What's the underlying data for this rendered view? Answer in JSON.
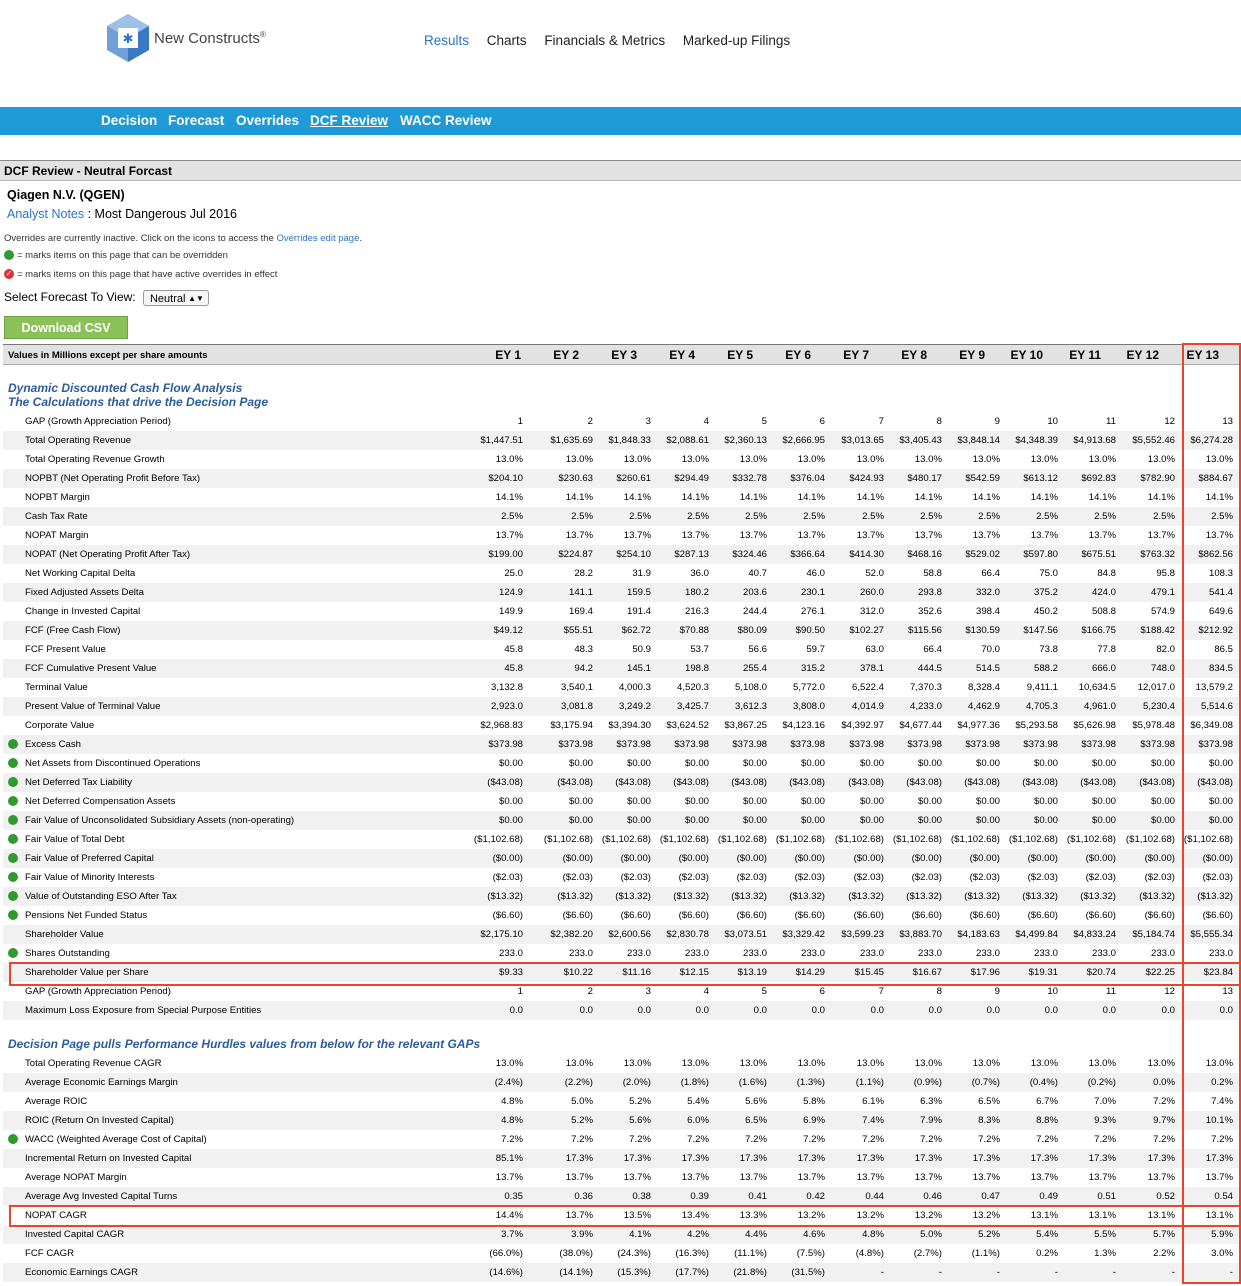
{
  "brand": {
    "name": "New Constructs",
    "mark": "®"
  },
  "topnav": [
    "Results",
    "Charts",
    "Financials & Metrics",
    "Marked-up Filings"
  ],
  "subnav": [
    "Decision",
    "Forecast",
    "Overrides",
    "DCF Review",
    "WACC Review"
  ],
  "section_title": "DCF Review - Neutral Forcast",
  "company": "Qiagen N.V. (QGEN)",
  "analyst": {
    "link": "Analyst Notes",
    "text": " : Most Dangerous Jul 2016"
  },
  "overrides_note": {
    "text": "Overrides are currently inactive. Click on the icons to access the ",
    "link": "Overrides edit page",
    "end": "."
  },
  "legend_green": "= marks items on this page that can be overridden",
  "legend_red": "= marks items on this page that have active overrides in effect",
  "forecast_select": {
    "label": "Select Forecast To View:",
    "value": "Neutral"
  },
  "csv_button": "Download CSV",
  "table_label": "Values in Millions except per share amounts",
  "columns": [
    "EY 1",
    "EY 2",
    "EY 3",
    "EY 4",
    "EY 5",
    "EY 6",
    "EY 7",
    "EY 8",
    "EY 9",
    "EY 10",
    "EY 11",
    "EY 12",
    "EY 13"
  ],
  "group1_title": [
    "Dynamic Discounted Cash Flow Analysis",
    "The Calculations that drive the Decision Page"
  ],
  "group1_rows": [
    {
      "label": "GAP (Growth Appreciation Period)",
      "dot": false,
      "values": [
        "1",
        "2",
        "3",
        "4",
        "5",
        "6",
        "7",
        "8",
        "9",
        "10",
        "11",
        "12",
        "13"
      ]
    },
    {
      "label": "Total Operating Revenue",
      "dot": false,
      "values": [
        "$1,447.51",
        "$1,635.69",
        "$1,848.33",
        "$2,088.61",
        "$2,360.13",
        "$2,666.95",
        "$3,013.65",
        "$3,405.43",
        "$3,848.14",
        "$4,348.39",
        "$4,913.68",
        "$5,552.46",
        "$6,274.28"
      ]
    },
    {
      "label": "Total Operating Revenue Growth",
      "dot": false,
      "values": [
        "13.0%",
        "13.0%",
        "13.0%",
        "13.0%",
        "13.0%",
        "13.0%",
        "13.0%",
        "13.0%",
        "13.0%",
        "13.0%",
        "13.0%",
        "13.0%",
        "13.0%"
      ]
    },
    {
      "label": "NOPBT (Net Operating Profit Before Tax)",
      "dot": false,
      "values": [
        "$204.10",
        "$230.63",
        "$260.61",
        "$294.49",
        "$332.78",
        "$376.04",
        "$424.93",
        "$480.17",
        "$542.59",
        "$613.12",
        "$692.83",
        "$782.90",
        "$884.67"
      ]
    },
    {
      "label": "NOPBT Margin",
      "dot": false,
      "values": [
        "14.1%",
        "14.1%",
        "14.1%",
        "14.1%",
        "14.1%",
        "14.1%",
        "14.1%",
        "14.1%",
        "14.1%",
        "14.1%",
        "14.1%",
        "14.1%",
        "14.1%"
      ]
    },
    {
      "label": "Cash Tax Rate",
      "dot": false,
      "values": [
        "2.5%",
        "2.5%",
        "2.5%",
        "2.5%",
        "2.5%",
        "2.5%",
        "2.5%",
        "2.5%",
        "2.5%",
        "2.5%",
        "2.5%",
        "2.5%",
        "2.5%"
      ]
    },
    {
      "label": "NOPAT Margin",
      "dot": false,
      "values": [
        "13.7%",
        "13.7%",
        "13.7%",
        "13.7%",
        "13.7%",
        "13.7%",
        "13.7%",
        "13.7%",
        "13.7%",
        "13.7%",
        "13.7%",
        "13.7%",
        "13.7%"
      ]
    },
    {
      "label": "NOPAT (Net Operating Profit After Tax)",
      "dot": false,
      "values": [
        "$199.00",
        "$224.87",
        "$254.10",
        "$287.13",
        "$324.46",
        "$366.64",
        "$414.30",
        "$468.16",
        "$529.02",
        "$597.80",
        "$675.51",
        "$763.32",
        "$862.56"
      ]
    },
    {
      "label": "Net Working Capital Delta",
      "dot": false,
      "values": [
        "25.0",
        "28.2",
        "31.9",
        "36.0",
        "40.7",
        "46.0",
        "52.0",
        "58.8",
        "66.4",
        "75.0",
        "84.8",
        "95.8",
        "108.3"
      ]
    },
    {
      "label": "Fixed Adjusted Assets Delta",
      "dot": false,
      "values": [
        "124.9",
        "141.1",
        "159.5",
        "180.2",
        "203.6",
        "230.1",
        "260.0",
        "293.8",
        "332.0",
        "375.2",
        "424.0",
        "479.1",
        "541.4"
      ]
    },
    {
      "label": "Change in Invested Capital",
      "dot": false,
      "values": [
        "149.9",
        "169.4",
        "191.4",
        "216.3",
        "244.4",
        "276.1",
        "312.0",
        "352.6",
        "398.4",
        "450.2",
        "508.8",
        "574.9",
        "649.6"
      ]
    },
    {
      "label": "FCF (Free Cash Flow)",
      "dot": false,
      "values": [
        "$49.12",
        "$55.51",
        "$62.72",
        "$70.88",
        "$80.09",
        "$90.50",
        "$102.27",
        "$115.56",
        "$130.59",
        "$147.56",
        "$166.75",
        "$188.42",
        "$212.92"
      ]
    },
    {
      "label": "FCF Present Value",
      "dot": false,
      "values": [
        "45.8",
        "48.3",
        "50.9",
        "53.7",
        "56.6",
        "59.7",
        "63.0",
        "66.4",
        "70.0",
        "73.8",
        "77.8",
        "82.0",
        "86.5"
      ]
    },
    {
      "label": "FCF Cumulative Present Value",
      "dot": false,
      "values": [
        "45.8",
        "94.2",
        "145.1",
        "198.8",
        "255.4",
        "315.2",
        "378.1",
        "444.5",
        "514.5",
        "588.2",
        "666.0",
        "748.0",
        "834.5"
      ]
    },
    {
      "label": "Terminal Value",
      "dot": false,
      "values": [
        "3,132.8",
        "3,540.1",
        "4,000.3",
        "4,520.3",
        "5,108.0",
        "5,772.0",
        "6,522.4",
        "7,370.3",
        "8,328.4",
        "9,411.1",
        "10,634.5",
        "12,017.0",
        "13,579.2"
      ]
    },
    {
      "label": "Present Value of Terminal Value",
      "dot": false,
      "values": [
        "2,923.0",
        "3,081.8",
        "3,249.2",
        "3,425.7",
        "3,612.3",
        "3,808.0",
        "4,014.9",
        "4,233.0",
        "4,462.9",
        "4,705.3",
        "4,961.0",
        "5,230.4",
        "5,514.6"
      ]
    },
    {
      "label": "Corporate Value",
      "dot": false,
      "values": [
        "$2,968.83",
        "$3,175.94",
        "$3,394.30",
        "$3,624.52",
        "$3,867.25",
        "$4,123.16",
        "$4,392.97",
        "$4,677.44",
        "$4,977.36",
        "$5,293.58",
        "$5,626.98",
        "$5,978.48",
        "$6,349.08"
      ]
    },
    {
      "label": "Excess Cash",
      "dot": true,
      "values": [
        "$373.98",
        "$373.98",
        "$373.98",
        "$373.98",
        "$373.98",
        "$373.98",
        "$373.98",
        "$373.98",
        "$373.98",
        "$373.98",
        "$373.98",
        "$373.98",
        "$373.98"
      ]
    },
    {
      "label": "Net Assets from Discontinued Operations",
      "dot": true,
      "values": [
        "$0.00",
        "$0.00",
        "$0.00",
        "$0.00",
        "$0.00",
        "$0.00",
        "$0.00",
        "$0.00",
        "$0.00",
        "$0.00",
        "$0.00",
        "$0.00",
        "$0.00"
      ]
    },
    {
      "label": "Net Deferred Tax Liability",
      "dot": true,
      "values": [
        "($43.08)",
        "($43.08)",
        "($43.08)",
        "($43.08)",
        "($43.08)",
        "($43.08)",
        "($43.08)",
        "($43.08)",
        "($43.08)",
        "($43.08)",
        "($43.08)",
        "($43.08)",
        "($43.08)"
      ]
    },
    {
      "label": "Net Deferred Compensation Assets",
      "dot": true,
      "values": [
        "$0.00",
        "$0.00",
        "$0.00",
        "$0.00",
        "$0.00",
        "$0.00",
        "$0.00",
        "$0.00",
        "$0.00",
        "$0.00",
        "$0.00",
        "$0.00",
        "$0.00"
      ]
    },
    {
      "label": "Fair Value of Unconsolidated Subsidiary Assets (non-operating)",
      "dot": true,
      "values": [
        "$0.00",
        "$0.00",
        "$0.00",
        "$0.00",
        "$0.00",
        "$0.00",
        "$0.00",
        "$0.00",
        "$0.00",
        "$0.00",
        "$0.00",
        "$0.00",
        "$0.00"
      ]
    },
    {
      "label": "Fair Value of Total Debt",
      "dot": true,
      "values": [
        "($1,102.68)",
        "($1,102.68)",
        "($1,102.68)",
        "($1,102.68)",
        "($1,102.68)",
        "($1,102.68)",
        "($1,102.68)",
        "($1,102.68)",
        "($1,102.68)",
        "($1,102.68)",
        "($1,102.68)",
        "($1,102.68)",
        "($1,102.68)"
      ]
    },
    {
      "label": "Fair Value of Preferred Capital",
      "dot": true,
      "values": [
        "($0.00)",
        "($0.00)",
        "($0.00)",
        "($0.00)",
        "($0.00)",
        "($0.00)",
        "($0.00)",
        "($0.00)",
        "($0.00)",
        "($0.00)",
        "($0.00)",
        "($0.00)",
        "($0.00)"
      ]
    },
    {
      "label": "Fair Value of Minority Interests",
      "dot": true,
      "values": [
        "($2.03)",
        "($2.03)",
        "($2.03)",
        "($2.03)",
        "($2.03)",
        "($2.03)",
        "($2.03)",
        "($2.03)",
        "($2.03)",
        "($2.03)",
        "($2.03)",
        "($2.03)",
        "($2.03)"
      ]
    },
    {
      "label": "Value of Outstanding ESO After Tax",
      "dot": true,
      "values": [
        "($13.32)",
        "($13.32)",
        "($13.32)",
        "($13.32)",
        "($13.32)",
        "($13.32)",
        "($13.32)",
        "($13.32)",
        "($13.32)",
        "($13.32)",
        "($13.32)",
        "($13.32)",
        "($13.32)"
      ]
    },
    {
      "label": "Pensions Net Funded Status",
      "dot": true,
      "values": [
        "($6.60)",
        "($6.60)",
        "($6.60)",
        "($6.60)",
        "($6.60)",
        "($6.60)",
        "($6.60)",
        "($6.60)",
        "($6.60)",
        "($6.60)",
        "($6.60)",
        "($6.60)",
        "($6.60)"
      ]
    },
    {
      "label": "Shareholder Value",
      "dot": false,
      "values": [
        "$2,175.10",
        "$2,382.20",
        "$2,600.56",
        "$2,830.78",
        "$3,073.51",
        "$3,329.42",
        "$3,599.23",
        "$3,883.70",
        "$4,183.63",
        "$4,499.84",
        "$4,833.24",
        "$5,184.74",
        "$5,555.34"
      ]
    },
    {
      "label": "Shares Outstanding",
      "dot": true,
      "values": [
        "233.0",
        "233.0",
        "233.0",
        "233.0",
        "233.0",
        "233.0",
        "233.0",
        "233.0",
        "233.0",
        "233.0",
        "233.0",
        "233.0",
        "233.0"
      ]
    },
    {
      "label": "Shareholder Value per Share",
      "dot": false,
      "values": [
        "$9.33",
        "$10.22",
        "$11.16",
        "$12.15",
        "$13.19",
        "$14.29",
        "$15.45",
        "$16.67",
        "$17.96",
        "$19.31",
        "$20.74",
        "$22.25",
        "$23.84"
      ]
    },
    {
      "label": "GAP (Growth Appreciation Period)",
      "dot": false,
      "values": [
        "1",
        "2",
        "3",
        "4",
        "5",
        "6",
        "7",
        "8",
        "9",
        "10",
        "11",
        "12",
        "13"
      ]
    },
    {
      "label": "Maximum Loss Exposure from Special Purpose Entities",
      "dot": false,
      "values": [
        "0.0",
        "0.0",
        "0.0",
        "0.0",
        "0.0",
        "0.0",
        "0.0",
        "0.0",
        "0.0",
        "0.0",
        "0.0",
        "0.0",
        "0.0"
      ]
    }
  ],
  "group2_title": "Decision Page pulls Performance Hurdles values from below for the relevant GAPs",
  "group2_rows": [
    {
      "label": "Total Operating Revenue CAGR",
      "dot": false,
      "values": [
        "13.0%",
        "13.0%",
        "13.0%",
        "13.0%",
        "13.0%",
        "13.0%",
        "13.0%",
        "13.0%",
        "13.0%",
        "13.0%",
        "13.0%",
        "13.0%",
        "13.0%"
      ]
    },
    {
      "label": "Average Economic Earnings Margin",
      "dot": false,
      "values": [
        "(2.4%)",
        "(2.2%)",
        "(2.0%)",
        "(1.8%)",
        "(1.6%)",
        "(1.3%)",
        "(1.1%)",
        "(0.9%)",
        "(0.7%)",
        "(0.4%)",
        "(0.2%)",
        "0.0%",
        "0.2%"
      ]
    },
    {
      "label": "Average ROIC",
      "dot": false,
      "values": [
        "4.8%",
        "5.0%",
        "5.2%",
        "5.4%",
        "5.6%",
        "5.8%",
        "6.1%",
        "6.3%",
        "6.5%",
        "6.7%",
        "7.0%",
        "7.2%",
        "7.4%"
      ]
    },
    {
      "label": "ROIC (Return On Invested Capital)",
      "dot": false,
      "values": [
        "4.8%",
        "5.2%",
        "5.6%",
        "6.0%",
        "6.5%",
        "6.9%",
        "7.4%",
        "7.9%",
        "8.3%",
        "8.8%",
        "9.3%",
        "9.7%",
        "10.1%"
      ]
    },
    {
      "label": "WACC (Weighted Average Cost of Capital)",
      "dot": true,
      "values": [
        "7.2%",
        "7.2%",
        "7.2%",
        "7.2%",
        "7.2%",
        "7.2%",
        "7.2%",
        "7.2%",
        "7.2%",
        "7.2%",
        "7.2%",
        "7.2%",
        "7.2%"
      ]
    },
    {
      "label": "Incremental Return on Invested Capital",
      "dot": false,
      "values": [
        "85.1%",
        "17.3%",
        "17.3%",
        "17.3%",
        "17.3%",
        "17.3%",
        "17.3%",
        "17.3%",
        "17.3%",
        "17.3%",
        "17.3%",
        "17.3%",
        "17.3%"
      ]
    },
    {
      "label": "Average NOPAT Margin",
      "dot": false,
      "values": [
        "13.7%",
        "13.7%",
        "13.7%",
        "13.7%",
        "13.7%",
        "13.7%",
        "13.7%",
        "13.7%",
        "13.7%",
        "13.7%",
        "13.7%",
        "13.7%",
        "13.7%"
      ]
    },
    {
      "label": "Average Avg Invested Capital Turns",
      "dot": false,
      "values": [
        "0.35",
        "0.36",
        "0.38",
        "0.39",
        "0.41",
        "0.42",
        "0.44",
        "0.46",
        "0.47",
        "0.49",
        "0.51",
        "0.52",
        "0.54"
      ]
    },
    {
      "label": "NOPAT CAGR",
      "dot": false,
      "values": [
        "14.4%",
        "13.7%",
        "13.5%",
        "13.4%",
        "13.3%",
        "13.2%",
        "13.2%",
        "13.2%",
        "13.2%",
        "13.1%",
        "13.1%",
        "13.1%",
        "13.1%"
      ]
    },
    {
      "label": "Invested Capital CAGR",
      "dot": false,
      "values": [
        "3.7%",
        "3.9%",
        "4.1%",
        "4.2%",
        "4.4%",
        "4.6%",
        "4.8%",
        "5.0%",
        "5.2%",
        "5.4%",
        "5.5%",
        "5.7%",
        "5.9%"
      ]
    },
    {
      "label": "FCF CAGR",
      "dot": false,
      "values": [
        "(66.0%)",
        "(38.0%)",
        "(24.3%)",
        "(16.3%)",
        "(11.1%)",
        "(7.5%)",
        "(4.8%)",
        "(2.7%)",
        "(1.1%)",
        "0.2%",
        "1.3%",
        "2.2%",
        "3.0%"
      ]
    },
    {
      "label": "Economic Earnings CAGR",
      "dot": false,
      "values": [
        "(14.6%)",
        "(14.1%)",
        "(15.3%)",
        "(17.7%)",
        "(21.8%)",
        "(31.5%)",
        "-",
        "-",
        "-",
        "-",
        "-",
        "-",
        "-"
      ]
    }
  ]
}
